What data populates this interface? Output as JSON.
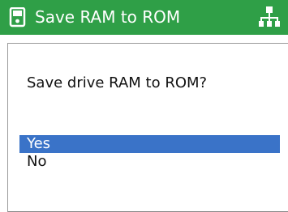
{
  "header": {
    "title": "Save RAM to ROM",
    "left_icon": "device-icon",
    "right_icon": "network-icon",
    "background_color": "#2f9f47"
  },
  "dialog": {
    "prompt": "Save drive RAM to ROM?",
    "options": [
      {
        "label": "Yes",
        "selected": true
      },
      {
        "label": "No",
        "selected": false
      }
    ],
    "selection_color": "#3a73c8"
  }
}
